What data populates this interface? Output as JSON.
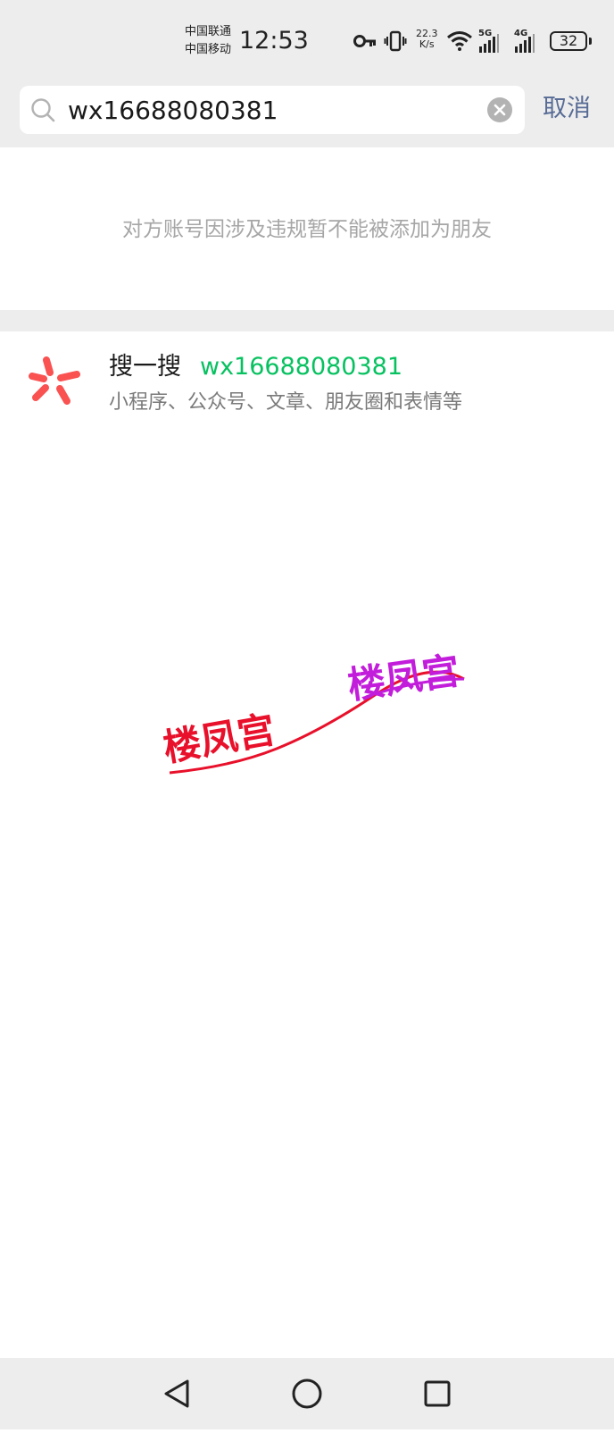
{
  "status_bar": {
    "carrier_1": "中国联通",
    "carrier_2": "中国移动",
    "time": "12:53",
    "net_speed_value": "22.3",
    "net_speed_unit": "K/s",
    "sim1_type": "5G",
    "sim2_type": "4G",
    "battery": "32"
  },
  "search": {
    "query": "wx16688080381",
    "cancel_label": "取消"
  },
  "notice": {
    "text": "对方账号因涉及违规暂不能被添加为朋友"
  },
  "sou_yi_sou": {
    "title": "搜一搜",
    "keyword": "wx16688080381",
    "subtitle": "小程序、公众号、文章、朋友圈和表情等",
    "icon_color": "#fa5151"
  },
  "watermark": {
    "text_left": "楼凤宫",
    "text_right": "楼凤宫",
    "color_left": "#e8102a",
    "color_right": "#c21ddb"
  },
  "colors": {
    "link_blue": "#576b95",
    "brand_green": "#07c160",
    "bar_gray": "#ededed"
  }
}
